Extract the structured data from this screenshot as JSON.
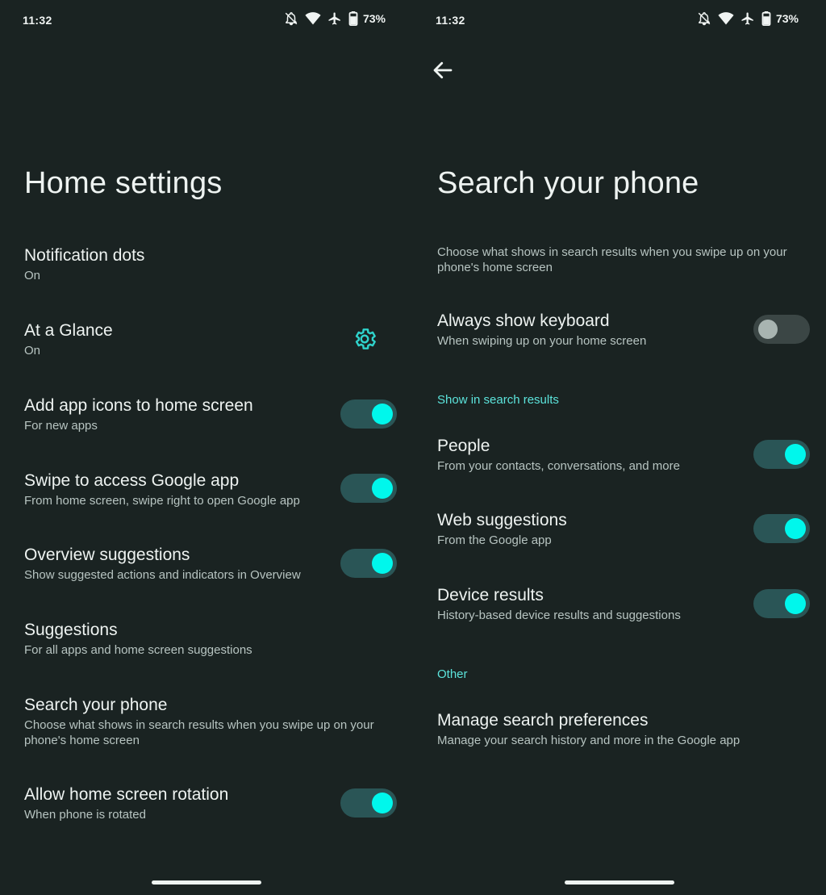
{
  "left": {
    "status": {
      "time": "11:32",
      "battery": "73%"
    },
    "title": "Home settings",
    "items": [
      {
        "title": "Notification dots",
        "subtitle": "On"
      },
      {
        "title": "At a Glance",
        "subtitle": "On"
      },
      {
        "title": "Add app icons to home screen",
        "subtitle": "For new apps",
        "toggle": true
      },
      {
        "title": "Swipe to access Google app",
        "subtitle": "From home screen, swipe right to open Google app",
        "toggle": true
      },
      {
        "title": "Overview suggestions",
        "subtitle": "Show suggested actions and indicators in Overview",
        "toggle": true
      },
      {
        "title": "Suggestions",
        "subtitle": "For all apps and home screen suggestions"
      },
      {
        "title": "Search your phone",
        "subtitle": "Choose what shows in search results when you swipe up on your phone's home screen"
      },
      {
        "title": "Allow home screen rotation",
        "subtitle": "When phone is rotated",
        "toggle": true
      }
    ]
  },
  "right": {
    "status": {
      "time": "11:32",
      "battery": "73%"
    },
    "title": "Search your phone",
    "description": "Choose what shows in search results when you swipe up on your phone's home screen",
    "keyboard": {
      "title": "Always show keyboard",
      "subtitle": "When swiping up on your home screen",
      "toggle": false
    },
    "section_results": "Show in search results",
    "results": [
      {
        "title": "People",
        "subtitle": "From your contacts, conversations, and more",
        "toggle": true
      },
      {
        "title": "Web suggestions",
        "subtitle": "From the Google app",
        "toggle": true
      },
      {
        "title": "Device results",
        "subtitle": "History-based device results and suggestions",
        "toggle": true
      }
    ],
    "section_other": "Other",
    "manage": {
      "title": "Manage search preferences",
      "subtitle": "Manage your search history and more in the Google app"
    }
  },
  "colors": {
    "background": "#1a2322",
    "accent": "#00f7ec",
    "section_header": "#5ce4dc",
    "toggle_track_on": "#2a5556",
    "toggle_track_off": "#3b4645"
  },
  "icons": [
    "notifications-off-icon",
    "wifi-icon",
    "airplane-icon",
    "battery-icon",
    "back-arrow-icon",
    "gear-icon"
  ]
}
